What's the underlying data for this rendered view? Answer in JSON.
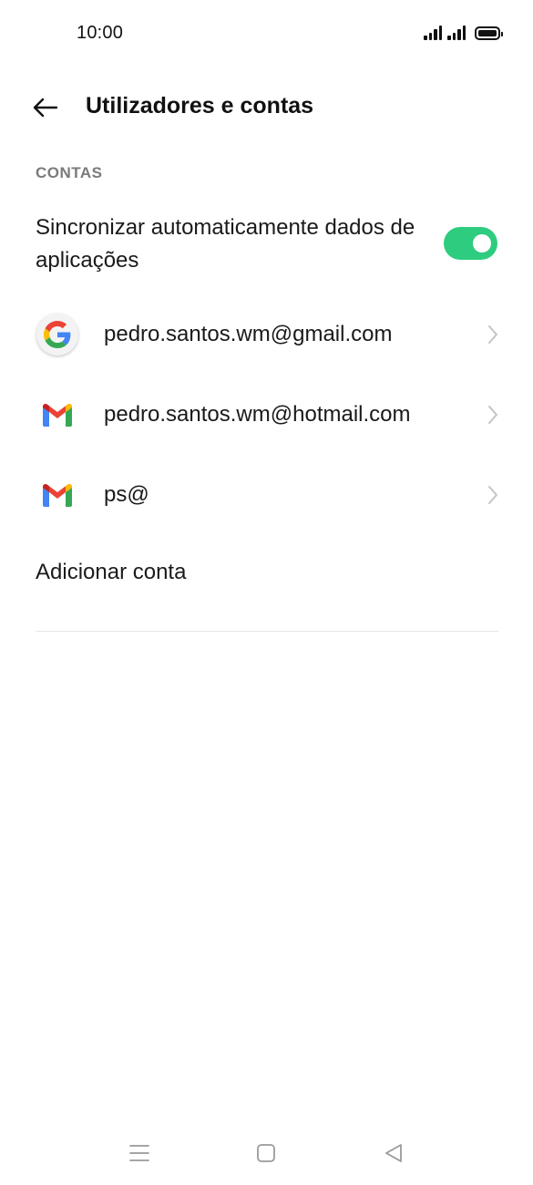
{
  "status_bar": {
    "time": "10:00",
    "icons": [
      "signal-icon",
      "signal-icon",
      "battery-icon"
    ]
  },
  "header": {
    "back_icon": "arrow-left-icon",
    "title": "Utilizadores e contas"
  },
  "section": {
    "header": "CONTAS"
  },
  "sync": {
    "label": "Sincronizar automaticamente dados de aplicações",
    "enabled": true,
    "toggle_color": "#2ecc7f"
  },
  "accounts": [
    {
      "icon": "google-icon",
      "label": "pedro.santos.wm@gmail.com"
    },
    {
      "icon": "gmail-icon",
      "label": "pedro.santos.wm@hotmail.com"
    },
    {
      "icon": "gmail-icon",
      "label": "ps@"
    }
  ],
  "add_account": {
    "label": "Adicionar conta"
  },
  "nav_bar": {
    "icons": [
      "menu-icon",
      "home-icon",
      "back-icon"
    ]
  }
}
